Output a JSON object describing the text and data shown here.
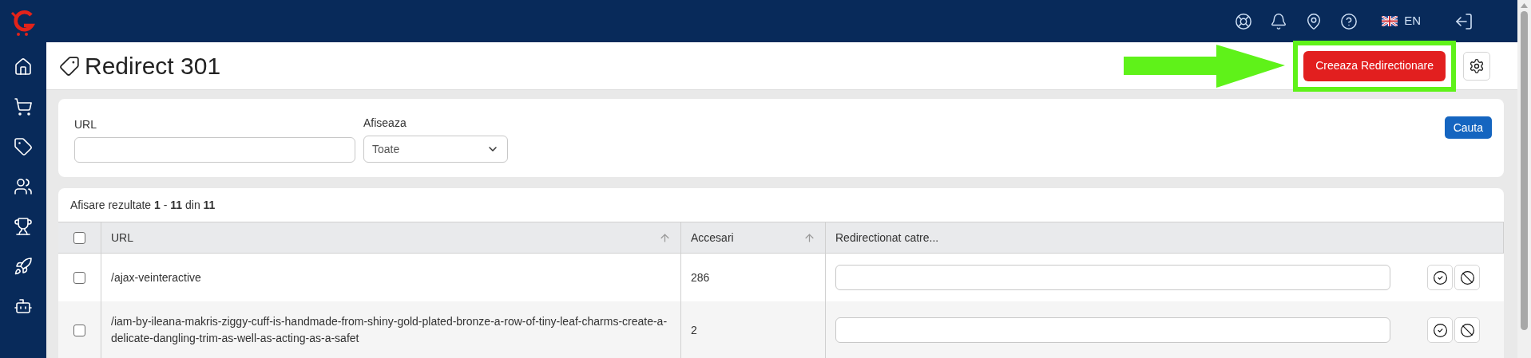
{
  "topbar": {
    "language": "EN"
  },
  "page": {
    "title": "Redirect 301",
    "create_button": "Creeaza Redirectionare"
  },
  "filters": {
    "url_label": "URL",
    "show_label": "Afiseaza",
    "show_value": "Toate",
    "search_button": "Cauta"
  },
  "results_summary": "Afisare rezultate **1** - **11** din **11**",
  "table": {
    "select_all_checked": false,
    "columns": [
      {
        "label": "URL",
        "sortable": true
      },
      {
        "label": "Accesari",
        "sortable": true
      },
      {
        "label": "Redirectionat catre...",
        "sortable": false
      }
    ],
    "rows": [
      {
        "checked": false,
        "url": "/ajax-veinteractive",
        "hits": "286"
      },
      {
        "checked": false,
        "url": "/iam-by-ileana-makris-ziggy-cuff-is-handmade-from-shiny-gold-plated-bronze-a-row-of-tiny-leaf-charms-create-a-delicate-dangling-trim-as-well-as-acting-as-a-safet",
        "hits": "2"
      }
    ]
  }
}
